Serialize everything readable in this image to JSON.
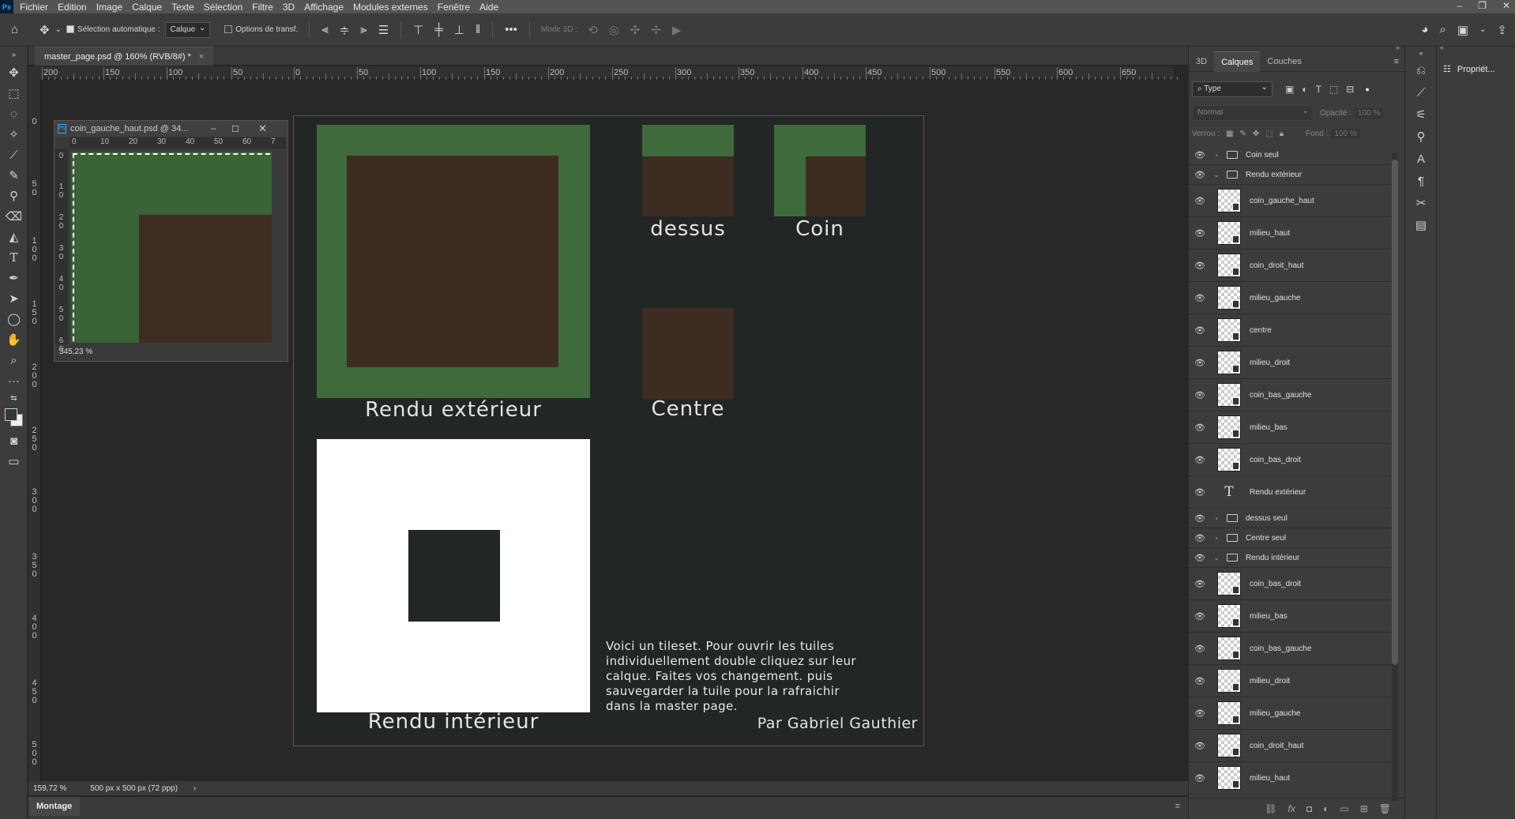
{
  "menu": [
    "Fichier",
    "Edition",
    "Image",
    "Calque",
    "Texte",
    "Sélection",
    "Filtre",
    "3D",
    "Affichage",
    "Modules externes",
    "Fenêtre",
    "Aide"
  ],
  "options": {
    "auto_select": "Sélection automatique :",
    "auto_select_target": "Calque",
    "transform_options": "Options de transf.",
    "mode3d": "Mode 3D :"
  },
  "document": {
    "tab_title": "master_page.psd @ 160% (RVB/8#) *",
    "close": "×"
  },
  "subwindow": {
    "title": "coin_gauche_haut.psd @ 34...",
    "zoom": "345,23 %"
  },
  "ruler_h": [
    "200",
    "150",
    "100",
    "50",
    "0",
    "50",
    "100",
    "150",
    "200",
    "250",
    "300",
    "350",
    "400",
    "450",
    "500",
    "550",
    "600",
    "650"
  ],
  "ruler_v": [
    "0",
    "5\n0",
    "1\n0\n0",
    "1\n5\n0",
    "2\n0\n0",
    "2\n5\n0",
    "3\n0\n0",
    "3\n5\n0",
    "4\n0\n0",
    "4\n5\n0",
    "5\n0\n0"
  ],
  "subruler_h": [
    "0",
    "10",
    "20",
    "30",
    "40",
    "50",
    "60",
    "7"
  ],
  "subruler_v": [
    "0",
    "1\n0",
    "2\n0",
    "3\n0",
    "4\n0",
    "5\n0",
    "6\n0"
  ],
  "canvas": {
    "rendu_exterieur": "Rendu extérieur",
    "dessus": "dessus",
    "coin": "Coin",
    "centre": "Centre",
    "rendu_interieur": "Rendu intérieur",
    "description": [
      "Voici un tileset. Pour ouvrir les tuiles",
      "individuellement double cliquez sur leur",
      "calque. Faites vos changement. puis",
      "sauvegarder la tuile pour la rafraichir",
      "dans la master page."
    ],
    "author": "Par Gabriel Gauthier"
  },
  "status": {
    "zoom": "159,72 %",
    "size": "500 px x 500 px (72 ppp)"
  },
  "timeline": {
    "label": "Montage"
  },
  "panel": {
    "tabs": [
      "3D",
      "Calques",
      "Couches"
    ],
    "filter": "Type",
    "blend": "Normal",
    "opacity_label": "Opacité :",
    "opacity": "100 %",
    "lock_label": "Verrou :",
    "fill_label": "Fond :",
    "fill": "100 %"
  },
  "layers": [
    {
      "kind": "group",
      "name": "Coin seul",
      "open": false
    },
    {
      "kind": "group",
      "name": "Rendu extérieur",
      "open": true
    },
    {
      "kind": "layer",
      "name": "coin_gauche_haut"
    },
    {
      "kind": "layer",
      "name": "milieu_haut"
    },
    {
      "kind": "layer",
      "name": "coin_droit_haut"
    },
    {
      "kind": "layer",
      "name": "milieu_gauche"
    },
    {
      "kind": "layer",
      "name": "centre"
    },
    {
      "kind": "layer",
      "name": "milieu_droit"
    },
    {
      "kind": "layer",
      "name": "coin_bas_gauche"
    },
    {
      "kind": "layer",
      "name": "milieu_bas"
    },
    {
      "kind": "layer",
      "name": "coin_bas_droit"
    },
    {
      "kind": "text",
      "name": "Rendu extérieur"
    },
    {
      "kind": "group",
      "name": "dessus seul",
      "open": false
    },
    {
      "kind": "group",
      "name": "Centre seul",
      "open": false
    },
    {
      "kind": "group",
      "name": "Rendu intérieur",
      "open": true
    },
    {
      "kind": "layer",
      "name": "coin_bas_droit"
    },
    {
      "kind": "layer",
      "name": "milieu_bas"
    },
    {
      "kind": "layer",
      "name": "coin_bas_gauche"
    },
    {
      "kind": "layer",
      "name": "milieu_droit"
    },
    {
      "kind": "layer",
      "name": "milieu_gauche"
    },
    {
      "kind": "layer",
      "name": "coin_droit_haut"
    },
    {
      "kind": "layer",
      "name": "milieu_haut"
    }
  ],
  "properties": {
    "label": "Propriét..."
  }
}
